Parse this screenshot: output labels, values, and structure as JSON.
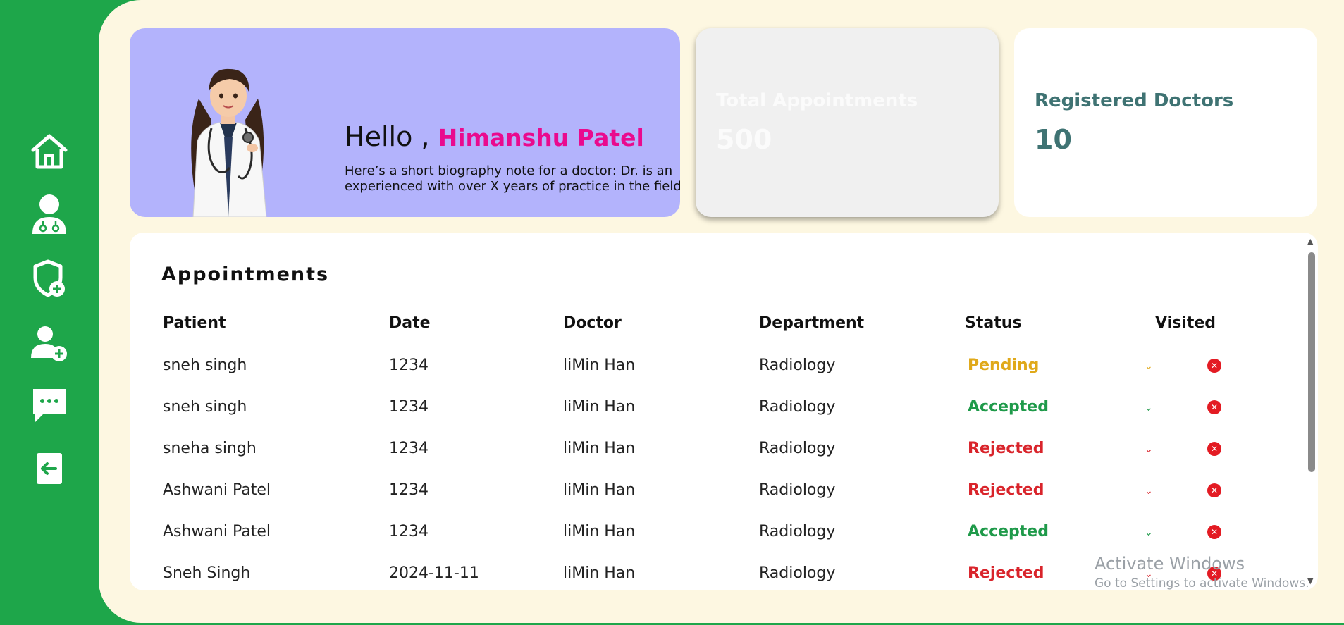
{
  "greeting": {
    "hello": "Hello ,",
    "name": "Himanshu Patel",
    "bio": "Here’s a short biography note for a doctor: Dr. is an experienced with over X years of practice in the field."
  },
  "stats": {
    "total_appointments_label": "Total Appointments",
    "total_appointments_value": "500",
    "registered_doctors_label": "Registered Doctors",
    "registered_doctors_value": "10"
  },
  "appointments": {
    "title": "Appointments",
    "headers": [
      "Patient",
      "Date",
      "Doctor",
      "Department",
      "Status",
      "Visited"
    ],
    "rows": [
      {
        "patient": "sneh singh",
        "date": "1234",
        "doctor": "liMin Han",
        "department": "Radiology",
        "status": "Pending"
      },
      {
        "patient": "sneh singh",
        "date": "1234",
        "doctor": "liMin Han",
        "department": "Radiology",
        "status": "Accepted"
      },
      {
        "patient": "sneha singh",
        "date": "1234",
        "doctor": "liMin Han",
        "department": "Radiology",
        "status": "Rejected"
      },
      {
        "patient": "Ashwani Patel",
        "date": "1234",
        "doctor": "liMin Han",
        "department": "Radiology",
        "status": "Rejected"
      },
      {
        "patient": "Ashwani Patel",
        "date": "1234",
        "doctor": "liMin Han",
        "department": "Radiology",
        "status": "Accepted"
      },
      {
        "patient": "Sneh Singh",
        "date": "2024-11-11",
        "doctor": "liMin Han",
        "department": "Radiology",
        "status": "Rejected"
      }
    ]
  },
  "status_colors": {
    "Pending": "#e0a91a",
    "Accepted": "#1f9a4a",
    "Rejected": "#d9242b"
  },
  "sidebar_icons": [
    "home-icon",
    "doctor-icon",
    "shield-plus-icon",
    "add-user-icon",
    "message-icon",
    "logout-icon"
  ],
  "watermark": {
    "line1": "Activate Windows",
    "line2": "Go to Settings to activate Windows."
  },
  "colors": {
    "sidebar": "#1ea64a",
    "page_bg": "#fdf7e1",
    "greeting_card": "#b3b3fc",
    "name_accent": "#ea0a8e",
    "doctors_stat": "#3f7373"
  }
}
